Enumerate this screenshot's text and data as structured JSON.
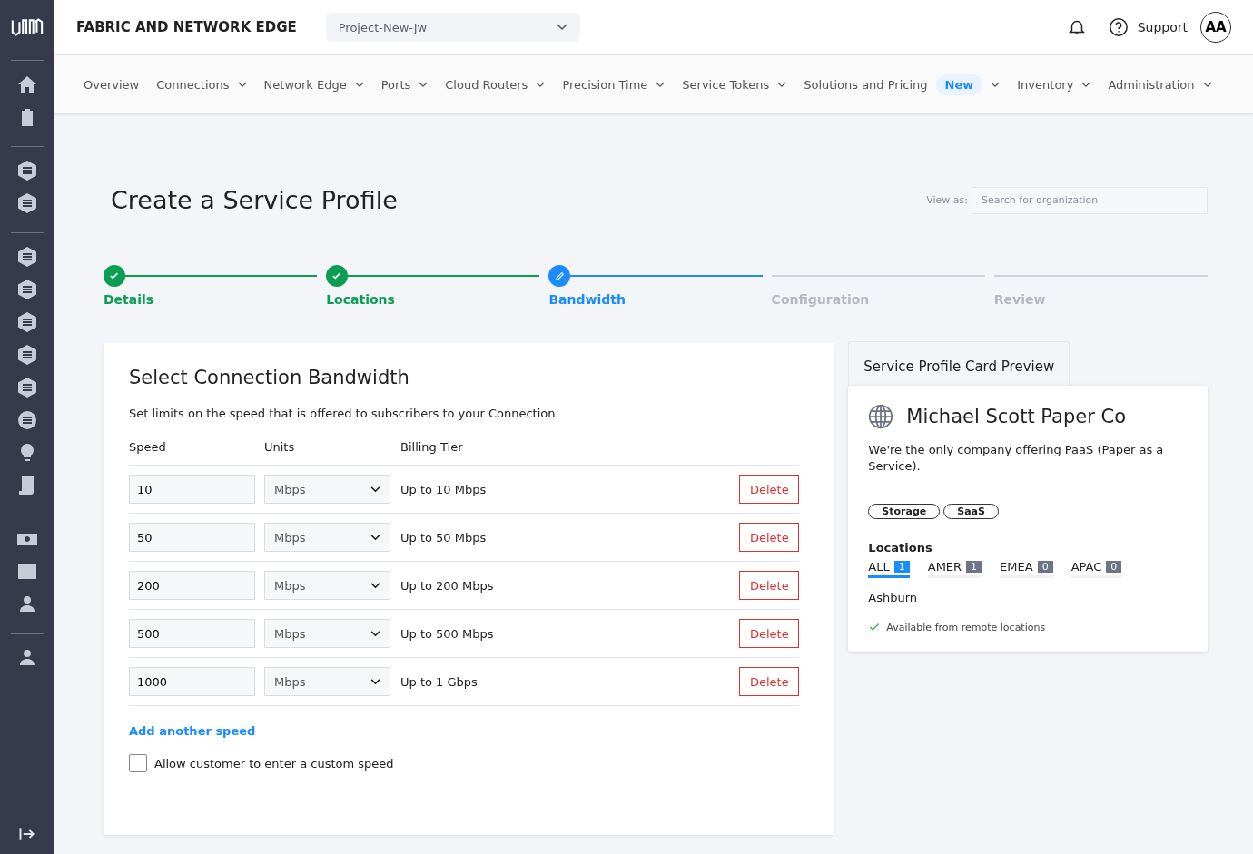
{
  "header": {
    "title": "FABRIC AND NETWORK EDGE",
    "project": "Project-New-Jw",
    "support": "Support",
    "avatar": "AA"
  },
  "nav": [
    {
      "label": "Overview",
      "dropdown": false
    },
    {
      "label": "Connections",
      "dropdown": true
    },
    {
      "label": "Network Edge",
      "dropdown": true
    },
    {
      "label": "Ports",
      "dropdown": true
    },
    {
      "label": "Cloud Routers",
      "dropdown": true
    },
    {
      "label": "Precision Time",
      "dropdown": true
    },
    {
      "label": "Service Tokens",
      "dropdown": true
    },
    {
      "label": "Solutions and Pricing",
      "dropdown": true,
      "badge": "New"
    },
    {
      "label": "Inventory",
      "dropdown": true
    },
    {
      "label": "Administration",
      "dropdown": true
    }
  ],
  "page": {
    "title": "Create a Service Profile",
    "view_as_label": "View as:",
    "view_as_placeholder": "Search for organization"
  },
  "steps": [
    {
      "label": "Details",
      "completed": true,
      "selected": false
    },
    {
      "label": "Locations",
      "completed": true,
      "selected": false
    },
    {
      "label": "Bandwidth",
      "completed": false,
      "selected": true
    },
    {
      "label": "Configuration",
      "completed": false,
      "selected": false
    },
    {
      "label": "Review",
      "completed": false,
      "selected": false
    }
  ],
  "bandwidth": {
    "title": "Select Connection Bandwidth",
    "description": "Set limits on the speed that is offered to subscribers to your Connection",
    "columns": [
      "Speed",
      "Units",
      "Billing Tier"
    ],
    "rows": [
      {
        "speed": "10",
        "units": "Mbps",
        "tier": "Up to 10 Mbps",
        "action": "Delete"
      },
      {
        "speed": "50",
        "units": "Mbps",
        "tier": "Up to 50 Mbps",
        "action": "Delete"
      },
      {
        "speed": "200",
        "units": "Mbps",
        "tier": "Up to 200 Mbps",
        "action": "Delete"
      },
      {
        "speed": "500",
        "units": "Mbps",
        "tier": "Up to 500 Mbps",
        "action": "Delete"
      },
      {
        "speed": "1000",
        "units": "Mbps",
        "tier": "Up to 1 Gbps",
        "action": "Delete"
      }
    ],
    "add_link": "Add another speed",
    "custom_speed": {
      "label": "Allow customer to enter a custom speed",
      "checked": false
    }
  },
  "preview": {
    "tab": "Service Profile Card Preview",
    "name": "Michael Scott Paper Co",
    "description": "We're the only company offering PaaS (Paper as a Service).",
    "tags": [
      "Storage",
      "SaaS"
    ],
    "locations_title": "Locations",
    "regions": [
      {
        "label": "ALL",
        "count": "1",
        "selected": true
      },
      {
        "label": "AMER",
        "count": "1",
        "selected": false
      },
      {
        "label": "EMEA",
        "count": "0",
        "selected": false
      },
      {
        "label": "APAC",
        "count": "0",
        "selected": false
      }
    ],
    "location": "Ashburn",
    "remote": "Available from remote locations"
  }
}
